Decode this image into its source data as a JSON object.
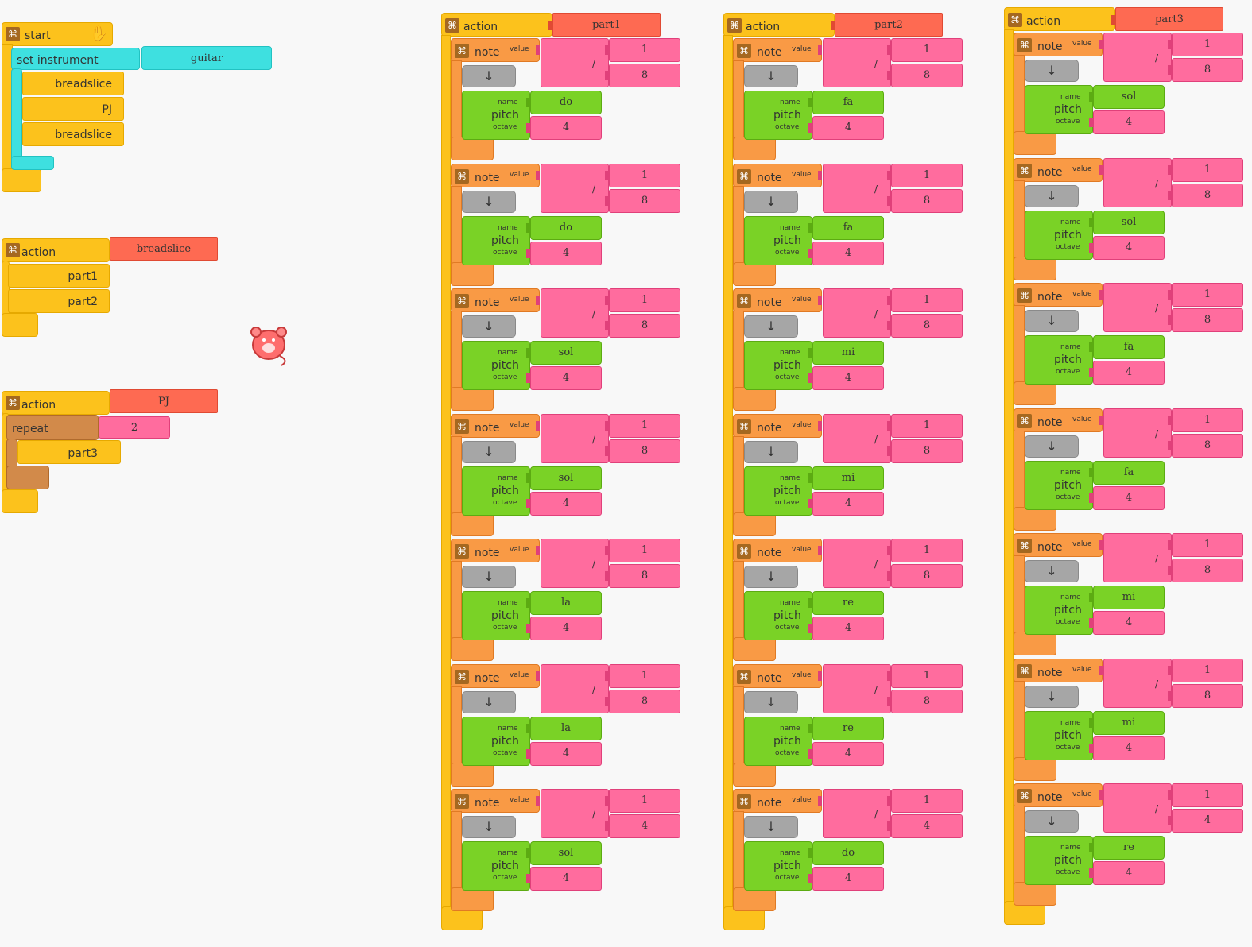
{
  "canvas": {
    "background": "#f8f8f8"
  },
  "colors": {
    "start": "#fcc21c",
    "instrument": "#3ee0e0",
    "note": "#f99a45",
    "pitch": "#7ad226",
    "number": "#ff6c9e",
    "name_tag": "#fe6a52",
    "repeat": "#d28a4a",
    "rest": "#a6a6a6"
  },
  "icons": {
    "collapse": "collapse-icon",
    "run_start": "hand-run-icon",
    "mouse": "mouse-turtle-icon",
    "divide": "/",
    "down_arrow": "↓"
  },
  "start_block": {
    "label": "start",
    "set_instrument_label": "set instrument",
    "instrument_value": "guitar",
    "calls": [
      "breadslice",
      "PJ",
      "breadslice"
    ]
  },
  "action_breadslice": {
    "label": "action",
    "name": "breadslice",
    "calls": [
      "part1",
      "part2"
    ]
  },
  "action_pj": {
    "label": "action",
    "name": "PJ",
    "repeat_label": "repeat",
    "repeat_count": "2",
    "calls": [
      "part3"
    ]
  },
  "note_labels": {
    "note": "note",
    "value": "value",
    "pitch": "pitch",
    "name": "name",
    "octave": "octave",
    "divide": "/",
    "down": "↓"
  },
  "actions": [
    {
      "label": "action",
      "name": "part1",
      "notes": [
        {
          "num": "1",
          "den": "8",
          "pitch": "do",
          "octave": "4"
        },
        {
          "num": "1",
          "den": "8",
          "pitch": "do",
          "octave": "4"
        },
        {
          "num": "1",
          "den": "8",
          "pitch": "sol",
          "octave": "4"
        },
        {
          "num": "1",
          "den": "8",
          "pitch": "sol",
          "octave": "4"
        },
        {
          "num": "1",
          "den": "8",
          "pitch": "la",
          "octave": "4"
        },
        {
          "num": "1",
          "den": "8",
          "pitch": "la",
          "octave": "4"
        },
        {
          "num": "1",
          "den": "4",
          "pitch": "sol",
          "octave": "4"
        }
      ]
    },
    {
      "label": "action",
      "name": "part2",
      "notes": [
        {
          "num": "1",
          "den": "8",
          "pitch": "fa",
          "octave": "4"
        },
        {
          "num": "1",
          "den": "8",
          "pitch": "fa",
          "octave": "4"
        },
        {
          "num": "1",
          "den": "8",
          "pitch": "mi",
          "octave": "4"
        },
        {
          "num": "1",
          "den": "8",
          "pitch": "mi",
          "octave": "4"
        },
        {
          "num": "1",
          "den": "8",
          "pitch": "re",
          "octave": "4"
        },
        {
          "num": "1",
          "den": "8",
          "pitch": "re",
          "octave": "4"
        },
        {
          "num": "1",
          "den": "4",
          "pitch": "do",
          "octave": "4"
        }
      ]
    },
    {
      "label": "action",
      "name": "part3",
      "notes": [
        {
          "num": "1",
          "den": "8",
          "pitch": "sol",
          "octave": "4"
        },
        {
          "num": "1",
          "den": "8",
          "pitch": "sol",
          "octave": "4"
        },
        {
          "num": "1",
          "den": "8",
          "pitch": "fa",
          "octave": "4"
        },
        {
          "num": "1",
          "den": "8",
          "pitch": "fa",
          "octave": "4"
        },
        {
          "num": "1",
          "den": "8",
          "pitch": "mi",
          "octave": "4"
        },
        {
          "num": "1",
          "den": "8",
          "pitch": "mi",
          "octave": "4"
        },
        {
          "num": "1",
          "den": "4",
          "pitch": "re",
          "octave": "4"
        }
      ]
    }
  ]
}
